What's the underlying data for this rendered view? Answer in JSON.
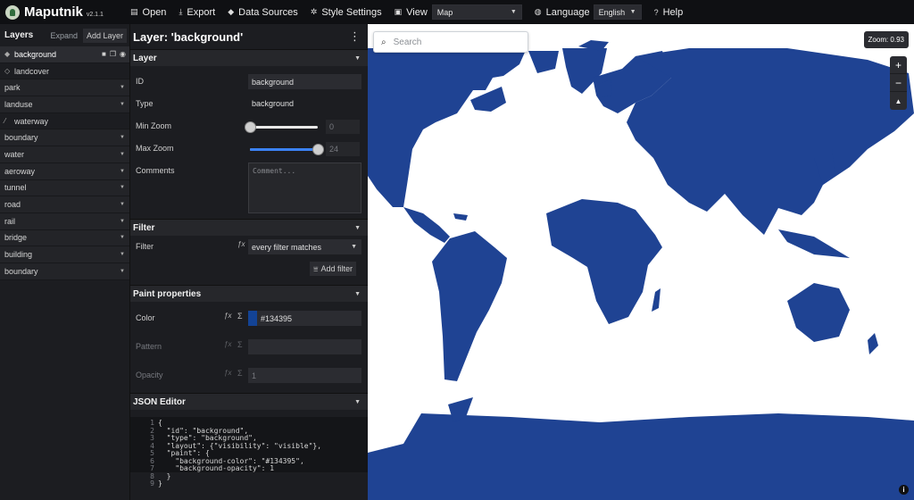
{
  "app": {
    "name": "Maputnik",
    "version": "v2.1.1"
  },
  "toolbar": {
    "open": "Open",
    "export": "Export",
    "data_sources": "Data Sources",
    "style_settings": "Style Settings",
    "view_label": "View",
    "view_value": "Map",
    "language_label": "Language",
    "language_value": "English",
    "help": "Help"
  },
  "layers_panel": {
    "title": "Layers",
    "expand": "Expand",
    "add_layer": "Add Layer",
    "items": [
      {
        "label": "background",
        "icon": "background-icon"
      },
      {
        "label": "landcover",
        "icon": "fill-icon"
      },
      {
        "label": "park"
      },
      {
        "label": "landuse"
      },
      {
        "label": "waterway",
        "icon": "line-icon"
      },
      {
        "label": "boundary"
      },
      {
        "label": "water"
      },
      {
        "label": "aeroway"
      },
      {
        "label": "tunnel"
      },
      {
        "label": "road"
      },
      {
        "label": "rail"
      },
      {
        "label": "bridge"
      },
      {
        "label": "building"
      },
      {
        "label": "boundary"
      }
    ]
  },
  "editor": {
    "title": "Layer: 'background'",
    "layer_section": {
      "heading": "Layer",
      "id_label": "ID",
      "id_value": "background",
      "type_label": "Type",
      "type_value": "background",
      "min_zoom_label": "Min Zoom",
      "min_zoom_value": "0",
      "min_zoom_level": 0,
      "max_zoom_label": "Max Zoom",
      "max_zoom_value": "24",
      "max_zoom_level": 24,
      "comments_label": "Comments",
      "comments_placeholder": "Comment..."
    },
    "filter_section": {
      "heading": "Filter",
      "filter_label": "Filter",
      "filter_value": "every filter matches",
      "add_filter": "Add filter"
    },
    "paint_section": {
      "heading": "Paint properties",
      "color_label": "Color",
      "color_value": "#134395",
      "pattern_label": "Pattern",
      "opacity_label": "Opacity",
      "opacity_value": "1"
    },
    "json_section": {
      "heading": "JSON Editor",
      "lines": [
        {
          "n": "1",
          "text": "{"
        },
        {
          "n": "2",
          "text": "  \"id\": \"background\","
        },
        {
          "n": "3",
          "text": "  \"type\": \"background\","
        },
        {
          "n": "4",
          "text": "  \"layout\": {\"visibility\": \"visible\"},"
        },
        {
          "n": "5",
          "text": "  \"paint\": {"
        },
        {
          "n": "6",
          "text": "    \"background-color\": \"#134395\","
        },
        {
          "n": "7",
          "text": "    \"background-opacity\": 1"
        },
        {
          "n": "8",
          "text": "  }"
        },
        {
          "n": "9",
          "text": "}"
        }
      ]
    }
  },
  "map": {
    "search_placeholder": "Search",
    "zoom_readout": "Zoom: 0.93",
    "land_color": "#1f4393",
    "water_color": "#ffffff",
    "zoom_in": "+",
    "zoom_out": "−",
    "compass": "▲",
    "info": "i"
  }
}
